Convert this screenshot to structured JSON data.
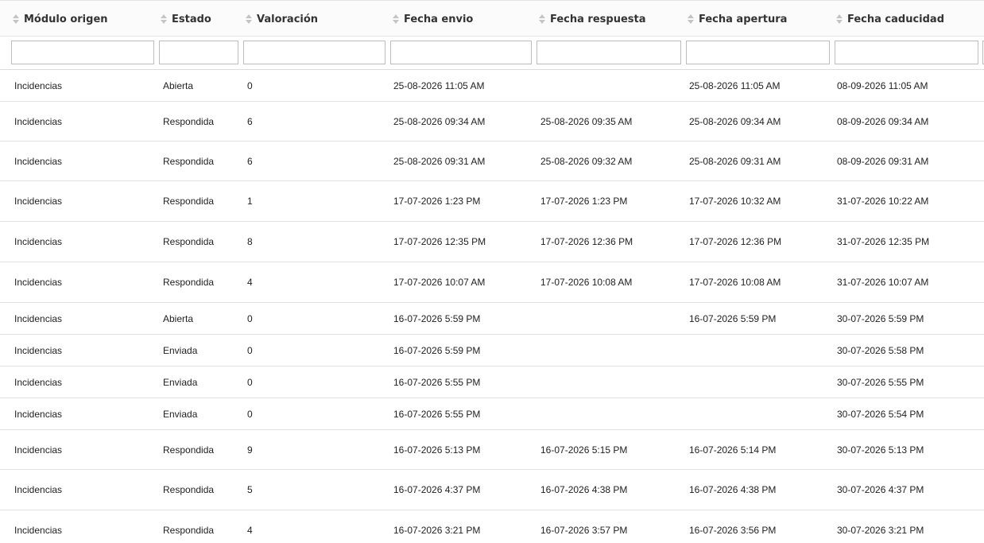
{
  "columns": [
    {
      "key": "modulo",
      "label": "Módulo origen"
    },
    {
      "key": "estado",
      "label": "Estado"
    },
    {
      "key": "valoracion",
      "label": "Valoración"
    },
    {
      "key": "envio",
      "label": "Fecha envio"
    },
    {
      "key": "respuesta",
      "label": "Fecha respuesta"
    },
    {
      "key": "apertura",
      "label": "Fecha apertura"
    },
    {
      "key": "caducidad",
      "label": "Fecha caducidad"
    }
  ],
  "filters": [
    "",
    "",
    "",
    "",
    "",
    "",
    ""
  ],
  "rows": [
    {
      "modulo": "Incidencias",
      "estado": "Abierta",
      "valoracion": "0",
      "envio": "25-08-2026 11:05 AM",
      "respuesta": "",
      "apertura": "25-08-2026 11:05 AM",
      "caducidad": "08-09-2026 11:05 AM"
    },
    {
      "modulo": "Incidencias",
      "estado": "Respondida",
      "valoracion": "6",
      "envio": "25-08-2026 09:34 AM",
      "respuesta": "25-08-2026 09:35 AM",
      "apertura": "25-08-2026 09:34 AM",
      "caducidad": "08-09-2026 09:34 AM"
    },
    {
      "modulo": "Incidencias",
      "estado": "Respondida",
      "valoracion": "6",
      "envio": "25-08-2026 09:31 AM",
      "respuesta": "25-08-2026 09:32 AM",
      "apertura": "25-08-2026 09:31 AM",
      "caducidad": "08-09-2026 09:31 AM"
    },
    {
      "modulo": "Incidencias",
      "estado": "Respondida",
      "valoracion": "1",
      "envio": "17-07-2026 1:23 PM",
      "respuesta": "17-07-2026 1:23 PM",
      "apertura": "17-07-2026 10:32 AM",
      "caducidad": "31-07-2026 10:22 AM"
    },
    {
      "modulo": "Incidencias",
      "estado": "Respondida",
      "valoracion": "8",
      "envio": "17-07-2026 12:35 PM",
      "respuesta": "17-07-2026 12:36 PM",
      "apertura": "17-07-2026 12:36 PM",
      "caducidad": "31-07-2026 12:35 PM"
    },
    {
      "modulo": "Incidencias",
      "estado": "Respondida",
      "valoracion": "4",
      "envio": "17-07-2026 10:07 AM",
      "respuesta": "17-07-2026 10:08 AM",
      "apertura": "17-07-2026 10:08 AM",
      "caducidad": "31-07-2026 10:07 AM"
    },
    {
      "modulo": "Incidencias",
      "estado": "Abierta",
      "valoracion": "0",
      "envio": "16-07-2026 5:59 PM",
      "respuesta": "",
      "apertura": "16-07-2026 5:59 PM",
      "caducidad": "30-07-2026 5:59 PM"
    },
    {
      "modulo": "Incidencias",
      "estado": "Enviada",
      "valoracion": "0",
      "envio": "16-07-2026 5:59 PM",
      "respuesta": "",
      "apertura": "",
      "caducidad": "30-07-2026 5:58 PM"
    },
    {
      "modulo": "Incidencias",
      "estado": "Enviada",
      "valoracion": "0",
      "envio": "16-07-2026 5:55 PM",
      "respuesta": "",
      "apertura": "",
      "caducidad": "30-07-2026 5:55 PM"
    },
    {
      "modulo": "Incidencias",
      "estado": "Enviada",
      "valoracion": "0",
      "envio": "16-07-2026 5:55 PM",
      "respuesta": "",
      "apertura": "",
      "caducidad": "30-07-2026 5:54 PM"
    },
    {
      "modulo": "Incidencias",
      "estado": "Respondida",
      "valoracion": "9",
      "envio": "16-07-2026 5:13 PM",
      "respuesta": "16-07-2026 5:15 PM",
      "apertura": "16-07-2026 5:14 PM",
      "caducidad": "30-07-2026 5:13 PM"
    },
    {
      "modulo": "Incidencias",
      "estado": "Respondida",
      "valoracion": "5",
      "envio": "16-07-2026 4:37 PM",
      "respuesta": "16-07-2026 4:38 PM",
      "apertura": "16-07-2026 4:38 PM",
      "caducidad": "30-07-2026 4:37 PM"
    },
    {
      "modulo": "Incidencias",
      "estado": "Respondida",
      "valoracion": "4",
      "envio": "16-07-2026 3:21 PM",
      "respuesta": "16-07-2026 3:57 PM",
      "apertura": "16-07-2026 3:56 PM",
      "caducidad": "30-07-2026 3:21 PM"
    }
  ]
}
